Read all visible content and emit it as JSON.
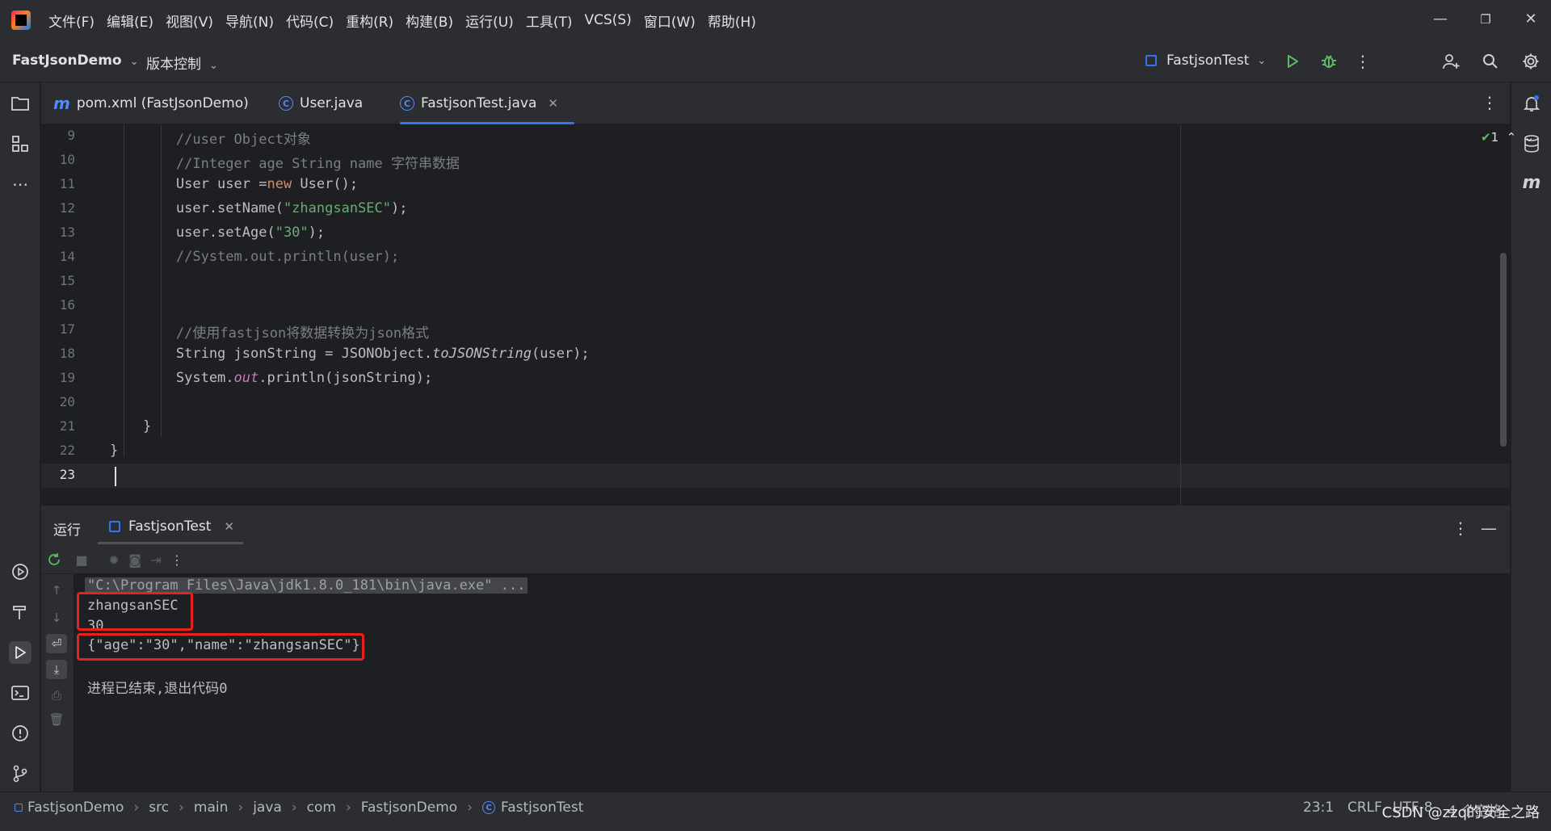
{
  "menubar": {
    "items": [
      "文件(F)",
      "编辑(E)",
      "视图(V)",
      "导航(N)",
      "代码(C)",
      "重构(R)",
      "构建(B)",
      "运行(U)",
      "工具(T)",
      "VCS(S)",
      "窗口(W)",
      "帮助(H)"
    ]
  },
  "toolbar": {
    "project": "FastJsonDemo",
    "vcs": "版本控制",
    "run_config": "FastjsonTest"
  },
  "tabs": [
    {
      "label": "pom.xml (FastJsonDemo)",
      "icon": "m"
    },
    {
      "label": "User.java",
      "icon": "C"
    },
    {
      "label": "FastjsonTest.java",
      "icon": "C",
      "active": true
    }
  ],
  "editor": {
    "inspection_count": "1",
    "lines": [
      {
        "num": "9",
        "text": "        //user Object对象"
      },
      {
        "num": "10",
        "text": "        //Integer age String name 字符串数据"
      },
      {
        "num": "11",
        "text": "        User user =new User();"
      },
      {
        "num": "12",
        "text": "        user.setName(\"zhangsanSEC\");"
      },
      {
        "num": "13",
        "text": "        user.setAge(\"30\");"
      },
      {
        "num": "14",
        "text": "        //System.out.println(user);"
      },
      {
        "num": "15",
        "text": ""
      },
      {
        "num": "16",
        "text": ""
      },
      {
        "num": "17",
        "text": "        //使用fastjson将数据转换为json格式"
      },
      {
        "num": "18",
        "text": "        String jsonString = JSONObject.toJSONString(user);"
      },
      {
        "num": "19",
        "text": "        System.out.println(jsonString);"
      },
      {
        "num": "20",
        "text": ""
      },
      {
        "num": "21",
        "text": "    }"
      },
      {
        "num": "22",
        "text": "}"
      },
      {
        "num": "23",
        "text": ""
      }
    ]
  },
  "run_panel": {
    "title": "运行",
    "tab": "FastjsonTest",
    "console": {
      "command": "\"C:\\Program Files\\Java\\jdk1.8.0_181\\bin\\java.exe\" ...",
      "output": [
        "zhangsanSEC",
        "30",
        "{\"age\":\"30\",\"name\":\"zhangsanSEC\"}",
        "",
        "进程已结束,退出代码0"
      ]
    }
  },
  "statusbar": {
    "breadcrumbs": [
      "FastjsonDemo",
      "src",
      "main",
      "java",
      "com",
      "FastjsonDemo",
      "FastjsonTest"
    ],
    "position": "23:1",
    "line_sep": "CRLF",
    "encoding": "UTF-8",
    "indent": "4 个空格"
  },
  "watermark": "CSDN @zzq的安全之路"
}
